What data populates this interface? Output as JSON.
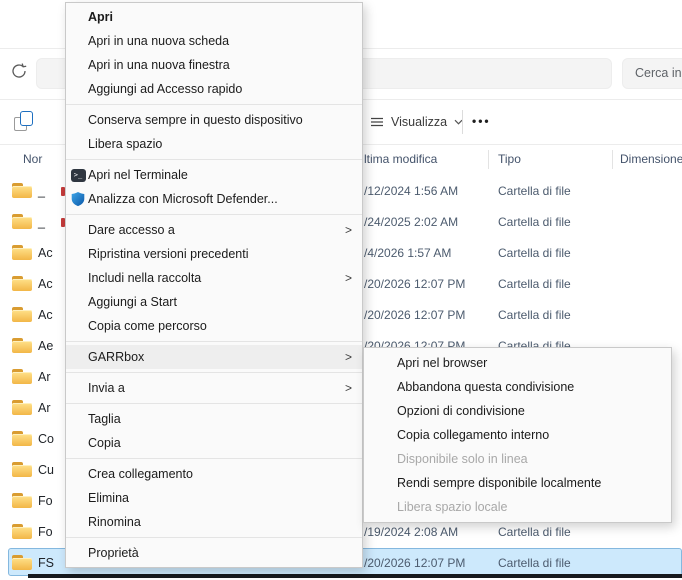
{
  "toolbar": {
    "search_text": "Cerca in"
  },
  "command_bar": {
    "view_label": "Visualizza",
    "more_label": "•••"
  },
  "list": {
    "columns": {
      "name": "Nor",
      "modified": "ltima modifica",
      "type": "Tipo",
      "size": "Dimensione"
    },
    "rows": [
      {
        "name": "_",
        "date": "/12/2024 1:56 AM",
        "type": "Cartella di file",
        "selected": false,
        "mark": true
      },
      {
        "name": "_",
        "date": "/24/2025 2:02 AM",
        "type": "Cartella di file",
        "selected": false,
        "mark": true
      },
      {
        "name": "Ac",
        "date": "/4/2026 1:57 AM",
        "type": "Cartella di file",
        "selected": false,
        "mark": false
      },
      {
        "name": "Ac",
        "date": "/20/2026 12:07 PM",
        "type": "Cartella di file",
        "selected": false,
        "mark": false
      },
      {
        "name": "Ac",
        "date": "/20/2026 12:07 PM",
        "type": "Cartella di file",
        "selected": false,
        "mark": false
      },
      {
        "name": "Ae",
        "date": "/20/2026 12:07 PM",
        "type": "Cartella di file",
        "selected": false,
        "mark": false
      },
      {
        "name": "Ar",
        "date": "",
        "type": "",
        "selected": false,
        "mark": false
      },
      {
        "name": "Ar",
        "date": "",
        "type": "",
        "selected": false,
        "mark": false
      },
      {
        "name": "Co",
        "date": "",
        "type": "",
        "selected": false,
        "mark": false
      },
      {
        "name": "Cu",
        "date": "",
        "type": "",
        "selected": false,
        "mark": false
      },
      {
        "name": "Fo",
        "date": "",
        "type": "",
        "selected": false,
        "mark": false
      },
      {
        "name": "Fo",
        "date": "/19/2024 2:08 AM",
        "type": "Cartella di file",
        "selected": false,
        "mark": false
      },
      {
        "name": "FS",
        "date": "/20/2026 12:07 PM",
        "type": "Cartella di file",
        "selected": true,
        "mark": false
      }
    ]
  },
  "context_menu": {
    "items": [
      {
        "label": "Apri",
        "bold": true
      },
      {
        "label": "Apri in una nuova scheda"
      },
      {
        "label": "Apri in una nuova finestra"
      },
      {
        "label": "Aggiungi ad Accesso rapido",
        "sep_after": true
      },
      {
        "label": "Conserva sempre in questo dispositivo"
      },
      {
        "label": "Libera spazio",
        "sep_after": true
      },
      {
        "label": "Apri nel Terminale",
        "icon": "terminal"
      },
      {
        "label": "Analizza con Microsoft Defender...",
        "icon": "defender",
        "sep_after": true
      },
      {
        "label": "Dare accesso a",
        "chevron": true
      },
      {
        "label": "Ripristina versioni precedenti"
      },
      {
        "label": "Includi nella raccolta",
        "chevron": true
      },
      {
        "label": "Aggiungi a Start"
      },
      {
        "label": "Copia come percorso",
        "sep_after": true
      },
      {
        "label": "GARRbox",
        "chevron": true,
        "highlight": true,
        "sep_after": true
      },
      {
        "label": "Invia a",
        "chevron": true,
        "sep_after": true
      },
      {
        "label": "Taglia"
      },
      {
        "label": "Copia",
        "sep_after": true
      },
      {
        "label": "Crea collegamento"
      },
      {
        "label": "Elimina"
      },
      {
        "label": "Rinomina",
        "sep_after": true
      },
      {
        "label": "Proprietà"
      }
    ]
  },
  "garrbox_submenu": {
    "items": [
      {
        "label": "Apri nel browser"
      },
      {
        "label": "Abbandona questa condivisione"
      },
      {
        "label": "Opzioni di condivisione"
      },
      {
        "label": "Copia collegamento interno"
      },
      {
        "label": "Disponibile solo in linea",
        "disabled": true
      },
      {
        "label": "Rendi sempre disponibile localmente"
      },
      {
        "label": "Libera spazio locale",
        "disabled": true
      }
    ]
  },
  "colors": {
    "selection_fill": "#cde9fc",
    "selection_border": "#84b8df",
    "accent_blue": "#1e6fc0",
    "folder_front": "#f2b647",
    "folder_back": "#d99c31",
    "menu_bg": "#fafafa"
  }
}
